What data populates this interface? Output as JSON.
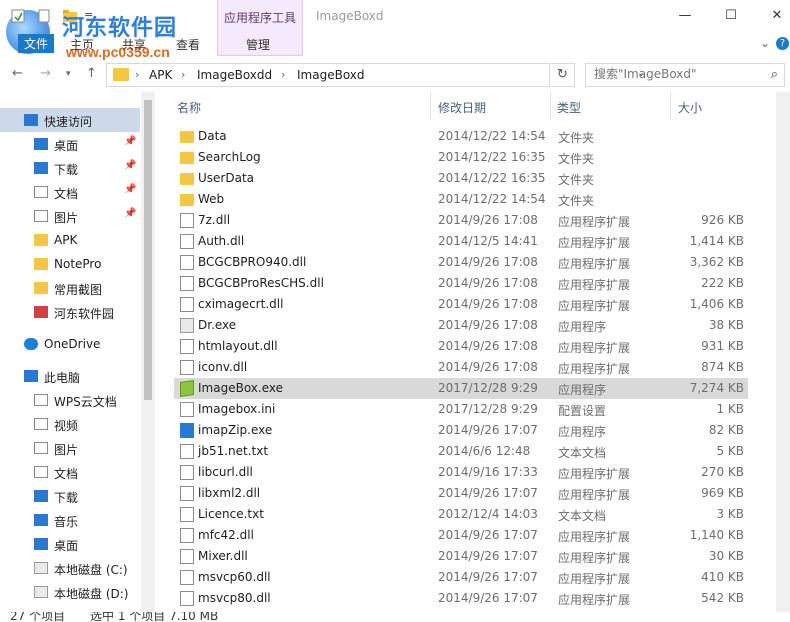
{
  "window": {
    "title": "ImageBoxd",
    "tool_context": "应用程序工具",
    "minimize": "—",
    "maximize": "☐",
    "close": "✕"
  },
  "watermark": {
    "title": "河东软件园",
    "url": "www.pc0359.cn"
  },
  "ribbon": {
    "tabs": [
      "文件",
      "主页",
      "共享",
      "查看",
      "管理"
    ],
    "help_icon": "?"
  },
  "address": {
    "crumbs": [
      "APK",
      "ImageBoxdd",
      "ImageBoxd"
    ],
    "search_placeholder": "搜索\"ImageBoxd\""
  },
  "columns": {
    "name": "名称",
    "date": "修改日期",
    "type": "类型",
    "size": "大小"
  },
  "nav": [
    {
      "label": "快速访问",
      "icon": "star-icon",
      "level": 0,
      "selected": true,
      "pinned": false
    },
    {
      "label": "桌面",
      "icon": "desktop-icon",
      "level": 1,
      "pinned": true
    },
    {
      "label": "下载",
      "icon": "download-icon",
      "level": 1,
      "pinned": true
    },
    {
      "label": "文档",
      "icon": "document-icon",
      "level": 1,
      "pinned": true
    },
    {
      "label": "图片",
      "icon": "pictures-icon",
      "level": 1,
      "pinned": true
    },
    {
      "label": "APK",
      "icon": "folder-icon",
      "level": 1,
      "pinned": false
    },
    {
      "label": "NotePro",
      "icon": "folder-icon",
      "level": 1,
      "pinned": false
    },
    {
      "label": "常用截图",
      "icon": "folder-icon",
      "level": 1,
      "pinned": false
    },
    {
      "label": "河东软件园",
      "icon": "folder-red-icon",
      "level": 1,
      "pinned": false
    },
    {
      "label": "OneDrive",
      "icon": "cloud-icon",
      "level": 0,
      "pinned": false
    },
    {
      "label": "此电脑",
      "icon": "computer-icon",
      "level": 0,
      "pinned": false
    },
    {
      "label": "WPS云文档",
      "icon": "cloud-outline-icon",
      "level": 1,
      "pinned": false
    },
    {
      "label": "视频",
      "icon": "video-icon",
      "level": 1,
      "pinned": false
    },
    {
      "label": "图片",
      "icon": "pictures-icon",
      "level": 1,
      "pinned": false
    },
    {
      "label": "文档",
      "icon": "document-icon",
      "level": 1,
      "pinned": false
    },
    {
      "label": "下载",
      "icon": "download-icon",
      "level": 1,
      "pinned": false
    },
    {
      "label": "音乐",
      "icon": "music-icon",
      "level": 1,
      "pinned": false
    },
    {
      "label": "桌面",
      "icon": "desktop-icon",
      "level": 1,
      "pinned": false
    },
    {
      "label": "本地磁盘 (C:)",
      "icon": "drive-icon",
      "level": 1,
      "pinned": false
    },
    {
      "label": "本地磁盘 (D:)",
      "icon": "drive-icon",
      "level": 1,
      "pinned": false
    }
  ],
  "files": [
    {
      "name": "Data",
      "date": "2014/12/22 14:54",
      "type": "文件夹",
      "size": "",
      "icon": "folder-icon"
    },
    {
      "name": "SearchLog",
      "date": "2014/12/22 16:35",
      "type": "文件夹",
      "size": "",
      "icon": "folder-icon"
    },
    {
      "name": "UserData",
      "date": "2014/12/22 16:35",
      "type": "文件夹",
      "size": "",
      "icon": "folder-icon"
    },
    {
      "name": "Web",
      "date": "2014/12/22 14:54",
      "type": "文件夹",
      "size": "",
      "icon": "folder-icon"
    },
    {
      "name": "7z.dll",
      "date": "2014/9/26 17:08",
      "type": "应用程序扩展",
      "size": "926 KB",
      "icon": "dll-icon"
    },
    {
      "name": "Auth.dll",
      "date": "2014/12/5 14:41",
      "type": "应用程序扩展",
      "size": "1,414 KB",
      "icon": "dll-icon"
    },
    {
      "name": "BCGCBPRO940.dll",
      "date": "2014/9/26 17:08",
      "type": "应用程序扩展",
      "size": "3,362 KB",
      "icon": "dll-icon"
    },
    {
      "name": "BCGCBProResCHS.dll",
      "date": "2014/9/26 17:08",
      "type": "应用程序扩展",
      "size": "222 KB",
      "icon": "dll-icon"
    },
    {
      "name": "cximagecrt.dll",
      "date": "2014/9/26 17:08",
      "type": "应用程序扩展",
      "size": "1,406 KB",
      "icon": "dll-icon"
    },
    {
      "name": "Dr.exe",
      "date": "2014/9/26 17:08",
      "type": "应用程序",
      "size": "38 KB",
      "icon": "exe-icon"
    },
    {
      "name": "htmlayout.dll",
      "date": "2014/9/26 17:08",
      "type": "应用程序扩展",
      "size": "931 KB",
      "icon": "dll-icon"
    },
    {
      "name": "iconv.dll",
      "date": "2014/9/26 17:08",
      "type": "应用程序扩展",
      "size": "874 KB",
      "icon": "dll-icon"
    },
    {
      "name": "ImageBox.exe",
      "date": "2017/12/28 9:29",
      "type": "应用程序",
      "size": "7,274 KB",
      "icon": "cube-icon",
      "selected": true
    },
    {
      "name": "Imagebox.ini",
      "date": "2017/12/28 9:29",
      "type": "配置设置",
      "size": "1 KB",
      "icon": "ini-icon"
    },
    {
      "name": "imapZip.exe",
      "date": "2014/9/26 17:07",
      "type": "应用程序",
      "size": "82 KB",
      "icon": "window-icon"
    },
    {
      "name": "jb51.net.txt",
      "date": "2014/6/6 12:48",
      "type": "文本文档",
      "size": "5 KB",
      "icon": "txt-icon"
    },
    {
      "name": "libcurl.dll",
      "date": "2014/9/16 17:33",
      "type": "应用程序扩展",
      "size": "270 KB",
      "icon": "dll-icon"
    },
    {
      "name": "libxml2.dll",
      "date": "2014/9/26 17:07",
      "type": "应用程序扩展",
      "size": "969 KB",
      "icon": "dll-icon"
    },
    {
      "name": "Licence.txt",
      "date": "2012/12/4 14:03",
      "type": "文本文档",
      "size": "3 KB",
      "icon": "txt-icon"
    },
    {
      "name": "mfc42.dll",
      "date": "2014/9/26 17:07",
      "type": "应用程序扩展",
      "size": "1,140 KB",
      "icon": "dll-icon"
    },
    {
      "name": "Mixer.dll",
      "date": "2014/9/26 17:07",
      "type": "应用程序扩展",
      "size": "30 KB",
      "icon": "dll-icon"
    },
    {
      "name": "msvcp60.dll",
      "date": "2014/9/26 17:07",
      "type": "应用程序扩展",
      "size": "410 KB",
      "icon": "dll-icon"
    },
    {
      "name": "msvcp80.dll",
      "date": "2014/9/26 17:07",
      "type": "应用程序扩展",
      "size": "542 KB",
      "icon": "dll-icon"
    }
  ],
  "status": {
    "count": "27 个项目",
    "selected": "选中 1 个项目  7.10 MB"
  },
  "colors": {
    "selection": "#ccd9ea",
    "row_selected": "#d9d9d9",
    "tool_context": "#f6e9fb",
    "folder": "#f4c742"
  }
}
